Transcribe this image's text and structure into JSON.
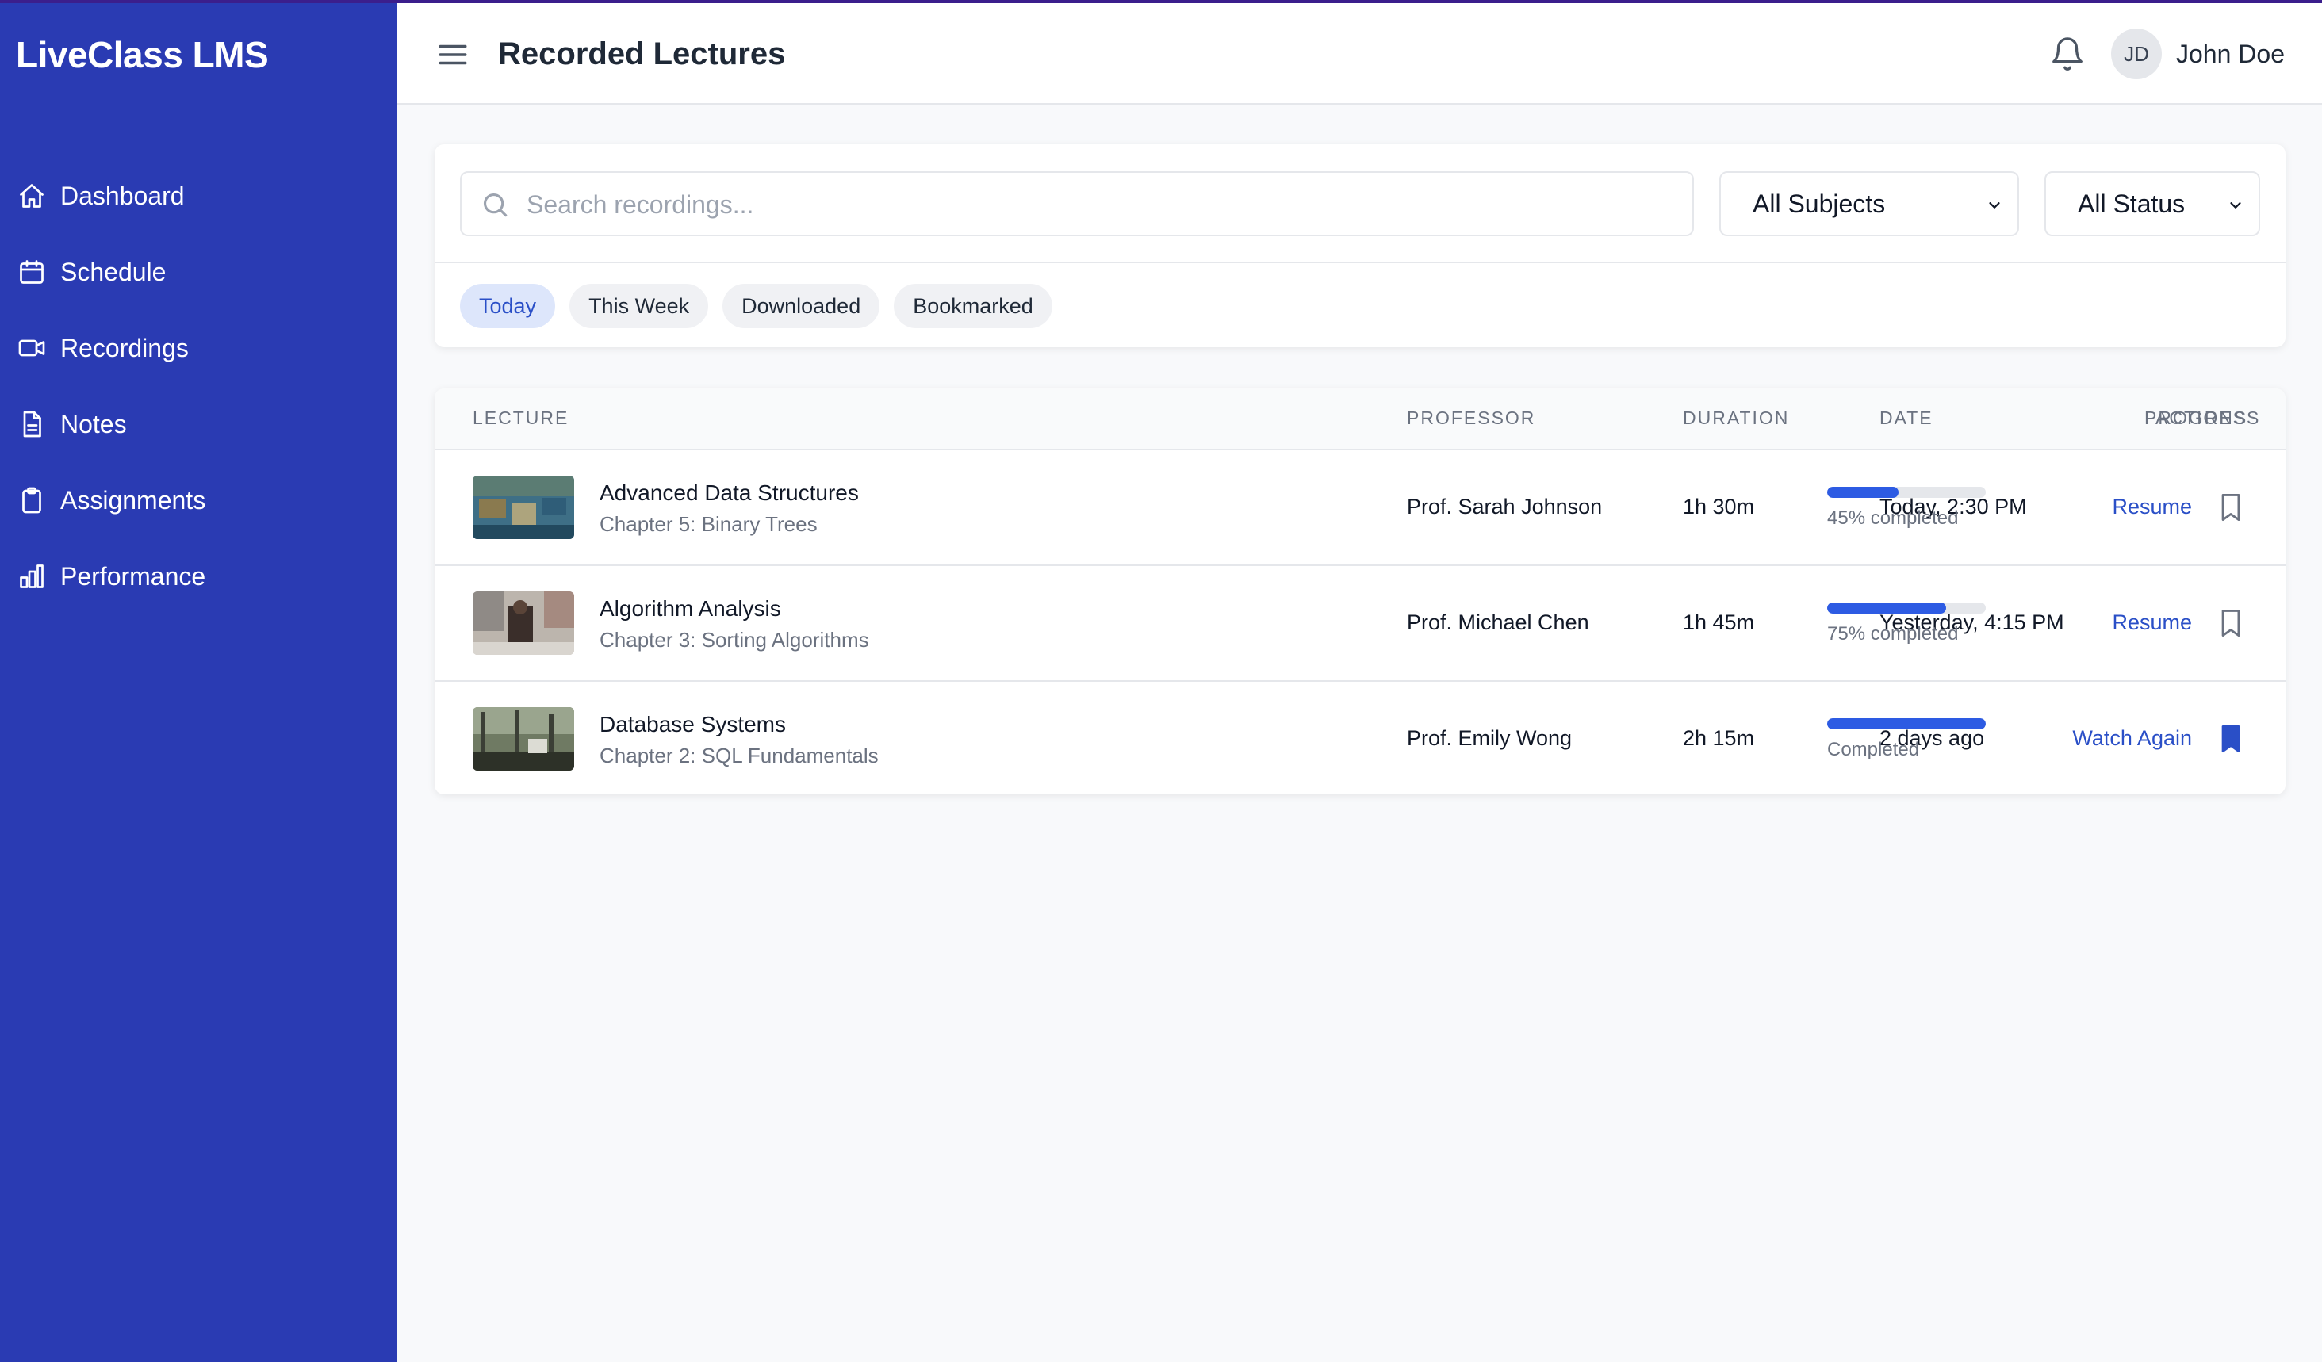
{
  "app": {
    "brand": "LiveClass LMS",
    "accent_color": "#2a3bb3"
  },
  "sidebar": {
    "items": [
      {
        "label": "Dashboard",
        "icon": "home-icon"
      },
      {
        "label": "Schedule",
        "icon": "calendar-icon"
      },
      {
        "label": "Recordings",
        "icon": "video-icon"
      },
      {
        "label": "Notes",
        "icon": "document-icon"
      },
      {
        "label": "Assignments",
        "icon": "clipboard-icon"
      },
      {
        "label": "Performance",
        "icon": "bar-chart-icon"
      }
    ]
  },
  "header": {
    "title": "Recorded Lectures",
    "user_initials": "JD",
    "user_name": "John Doe"
  },
  "filters": {
    "search_placeholder": "Search recordings...",
    "subject_select": "All Subjects",
    "status_select": "All Status",
    "chips": [
      "Today",
      "This Week",
      "Downloaded",
      "Bookmarked"
    ],
    "active_chip": "Today"
  },
  "table": {
    "columns": [
      "LECTURE",
      "PROFESSOR",
      "DURATION",
      "DATE",
      "PROGRESS",
      "ACTIONS"
    ],
    "rows": [
      {
        "title": "Advanced Data Structures",
        "chapter": "Chapter 5: Binary Trees",
        "professor": "Prof. Sarah Johnson",
        "duration": "1h 30m",
        "date": "Today, 2:30 PM",
        "progress": 0.45,
        "progress_label": "45% completed",
        "action": "Resume",
        "bookmarked": false
      },
      {
        "title": "Algorithm Analysis",
        "chapter": "Chapter 3: Sorting Algorithms",
        "professor": "Prof. Michael Chen",
        "duration": "1h 45m",
        "date": "Yesterday, 4:15 PM",
        "progress": 0.75,
        "progress_label": "75% completed",
        "action": "Resume",
        "bookmarked": false
      },
      {
        "title": "Database Systems",
        "chapter": "Chapter 2: SQL Fundamentals",
        "professor": "Prof. Emily Wong",
        "duration": "2h 15m",
        "date": "2 days ago",
        "progress": 1.0,
        "progress_label": "Completed",
        "action": "Watch Again",
        "bookmarked": true
      }
    ]
  }
}
